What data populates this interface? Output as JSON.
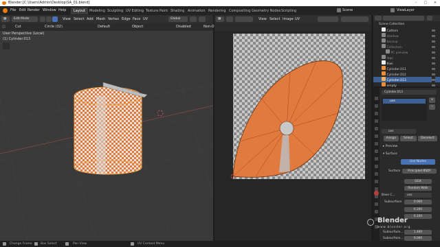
{
  "window_title": "Blender [C:\\Users\\Admin\\Desktop\\SA_01.blend]",
  "menu": [
    "File",
    "Edit",
    "Render",
    "Window",
    "Help"
  ],
  "workspaces": [
    "Layout",
    "Modeling",
    "Sculpting",
    "UV Editing",
    "Texture Paint",
    "Shading",
    "Animation",
    "Rendering",
    "Compositing",
    "Geometry Nodes",
    "Scripting"
  ],
  "active_workspace": "Layout",
  "scene": {
    "label": "Scene",
    "view_layer": "ViewLayer"
  },
  "viewport": {
    "mode": "Edit Mode",
    "menus": [
      "View",
      "Select",
      "Add",
      "Mesh",
      "Vertex",
      "Edge",
      "Face",
      "UV"
    ],
    "row2": {
      "cut": "Cut",
      "circle": "Circle (32)",
      "default": "Default",
      "object": "Object",
      "disabled": "Disabled",
      "non": "Non-D"
    },
    "transform": "Global",
    "perspective": "User Perspective (Local)",
    "object_name": "(1) Cylinder.013"
  },
  "uv_editor": {
    "menus": [
      "View",
      "Select",
      "Image",
      "UV"
    ]
  },
  "outliner": {
    "items": [
      {
        "label": "Scene Collection",
        "sel": false
      },
      {
        "label": "Cutters",
        "sel": false
      },
      {
        "label": "shadow",
        "sel": false
      },
      {
        "label": "backup",
        "sel": false
      },
      {
        "label": "Collection",
        "sel": false
      },
      {
        "label": "PC preview",
        "sel": false
      },
      {
        "label": "legs",
        "sel": false
      },
      {
        "label": "Kiwi",
        "sel": false
      },
      {
        "label": "Cylinder.011",
        "sel": false
      },
      {
        "label": "Cylinder.012",
        "sel": false
      },
      {
        "label": "Cylinder.013",
        "sel": true
      },
      {
        "label": "empty",
        "sel": false
      }
    ]
  },
  "properties": {
    "object_name": "Cylinder.013",
    "material_slot": "uvs",
    "material_name": "uvs",
    "actions": [
      "Assign",
      "Select",
      "Deselect"
    ],
    "panels": {
      "preview": "Preview",
      "surface": "Surface"
    },
    "use_nodes": "Use Nodes",
    "surface_label": "Surface",
    "surface_value": "Principled BSDF",
    "distribution": "GGX",
    "subsurface_method": "Random Walk",
    "base_color_label": "Base C...",
    "base_color_value": "uvs",
    "rows": [
      {
        "label": "Subsurface",
        "value": "0.000"
      },
      {
        "label": "",
        "value": "0.200"
      },
      {
        "label": "",
        "value": "0.100"
      },
      {
        "label": "Subsurface...",
        "value": "1.400"
      },
      {
        "label": "Subsurface...",
        "value": "0.000"
      }
    ]
  },
  "status": [
    "Change Frame",
    "Box Select",
    "Pan View",
    "UV Context Menu"
  ],
  "watermark": {
    "line1": "Blender",
    "line2": "www.blender.org"
  },
  "colors": {
    "accent": "#3e5f93",
    "checker_orange": "#e07a3e",
    "active_obj": "#f19b3a"
  }
}
